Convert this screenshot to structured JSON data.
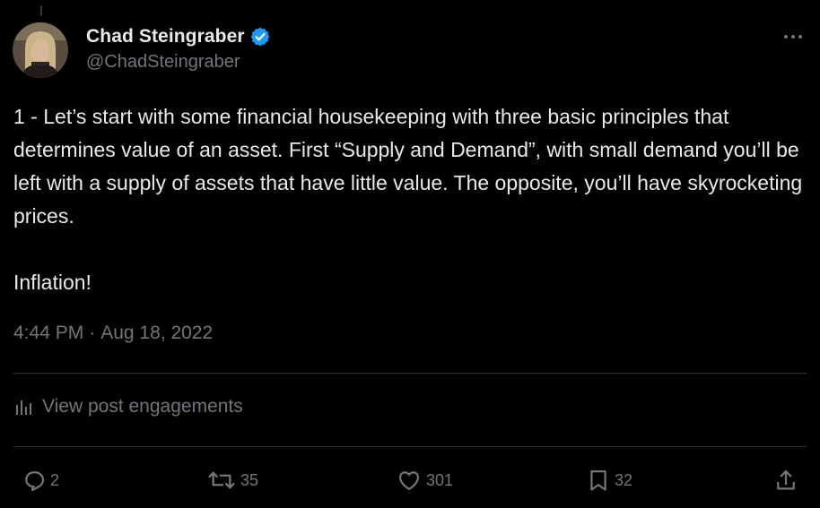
{
  "author": {
    "display_name": "Chad Steingraber",
    "handle": "@ChadSteingraber",
    "verified_color": "#1d9bf0"
  },
  "tweet": {
    "text": "1 - Let’s start with some financial housekeeping with three basic principles that determines value of an asset. First “Supply and Demand”, with small demand you’ll be left with a supply of assets that have little value. The opposite, you’ll have skyrocketing prices.\n\nInflation!",
    "time": "4:44 PM",
    "separator": "·",
    "date": "Aug 18, 2022"
  },
  "engagements": {
    "label": "View post engagements",
    "icon": "analytics-icon"
  },
  "actions": {
    "replies": "2",
    "reposts": "35",
    "likes": "301",
    "bookmarks": "32"
  },
  "colors": {
    "background": "#000000",
    "text_primary": "#e7e9ea",
    "text_secondary": "#71767b",
    "divider": "#2f3336",
    "accent": "#1d9bf0"
  }
}
